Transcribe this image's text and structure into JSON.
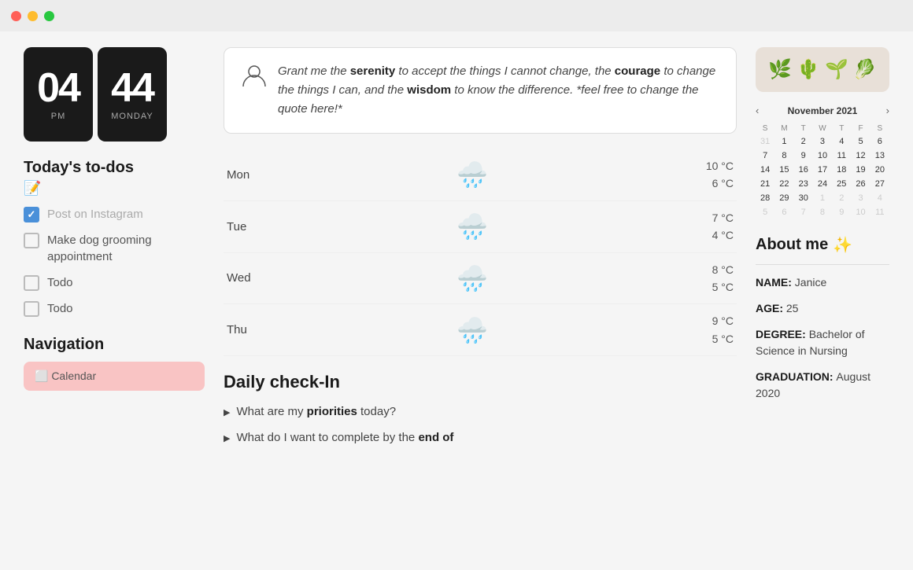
{
  "titlebar": {
    "buttons": [
      "close",
      "minimize",
      "maximize"
    ]
  },
  "clock": {
    "hours": "04",
    "minutes": "44",
    "period": "PM",
    "day": "MONDAY"
  },
  "todos": {
    "section_title": "Today's to-dos",
    "edit_icon": "📝",
    "items": [
      {
        "id": 1,
        "text": "Post on Instagram",
        "checked": true
      },
      {
        "id": 2,
        "text": "Make dog grooming appointment",
        "checked": false
      },
      {
        "id": 3,
        "text": "Todo",
        "checked": false
      },
      {
        "id": 4,
        "text": "Todo",
        "checked": false
      }
    ]
  },
  "navigation": {
    "title": "Navigation",
    "items": [
      "⬜ Calendar"
    ]
  },
  "quote": {
    "icon": "👤",
    "text_parts": [
      {
        "text": "Grant me the ",
        "bold": false
      },
      {
        "text": "serenity",
        "bold": true
      },
      {
        "text": " to accept the things I cannot change, the ",
        "bold": false
      },
      {
        "text": "courage",
        "bold": true
      },
      {
        "text": " to change the things I can, and the ",
        "bold": false
      },
      {
        "text": "wisdom",
        "bold": true
      },
      {
        "text": " to know the difference. *feel free to change the quote here!*",
        "bold": false
      }
    ]
  },
  "weather": {
    "rows": [
      {
        "day": "Mon",
        "high": "10 °C",
        "low": "6 °C"
      },
      {
        "day": "Tue",
        "high": "7 °C",
        "low": "4 °C"
      },
      {
        "day": "Wed",
        "high": "8 °C",
        "low": "5 °C"
      },
      {
        "day": "Thu",
        "high": "9 °C",
        "low": "5 °C"
      }
    ]
  },
  "daily_checkin": {
    "title": "Daily check-In",
    "items": [
      {
        "text_parts": [
          {
            "text": "What are my ",
            "bold": false
          },
          {
            "text": "priorities",
            "bold": true
          },
          {
            "text": " today?",
            "bold": false
          }
        ]
      },
      {
        "text_parts": [
          {
            "text": "What do I want to complete by the ",
            "bold": false
          },
          {
            "text": "end of",
            "bold": true
          }
        ]
      }
    ]
  },
  "plants": {
    "emojis": [
      "🌿",
      "🌵",
      "🌱",
      "🥬"
    ]
  },
  "calendar": {
    "month": "November 2021",
    "days_header": [
      "S",
      "M",
      "T",
      "W",
      "T",
      "F",
      "S"
    ],
    "weeks": [
      [
        "31",
        "1",
        "2",
        "3",
        "4",
        "5",
        "6"
      ],
      [
        "7",
        "8",
        "9",
        "10",
        "11",
        "12",
        "13"
      ],
      [
        "14",
        "15",
        "16",
        "17",
        "18",
        "19",
        "20"
      ],
      [
        "21",
        "22",
        "23",
        "24",
        "25",
        "26",
        "27"
      ],
      [
        "28",
        "29",
        "30",
        "1",
        "2",
        "3",
        "4"
      ],
      [
        "5",
        "6",
        "7",
        "8",
        "9",
        "10",
        "11"
      ]
    ],
    "other_month_indices": {
      "0": [
        0
      ],
      "4": [
        3,
        4,
        5,
        6
      ],
      "5": [
        0,
        1,
        2,
        3,
        4,
        5,
        6
      ]
    },
    "today": {
      "week": 0,
      "day": 1
    }
  },
  "about_me": {
    "title": "About me",
    "sparkle": "✨",
    "items": [
      {
        "label": "NAME",
        "value": "Janice"
      },
      {
        "label": "AGE",
        "value": "25"
      },
      {
        "label": "DEGREE",
        "value": "Bachelor of Science in Nursing"
      },
      {
        "label": "GRADUATION",
        "value": "August 2020"
      }
    ]
  }
}
